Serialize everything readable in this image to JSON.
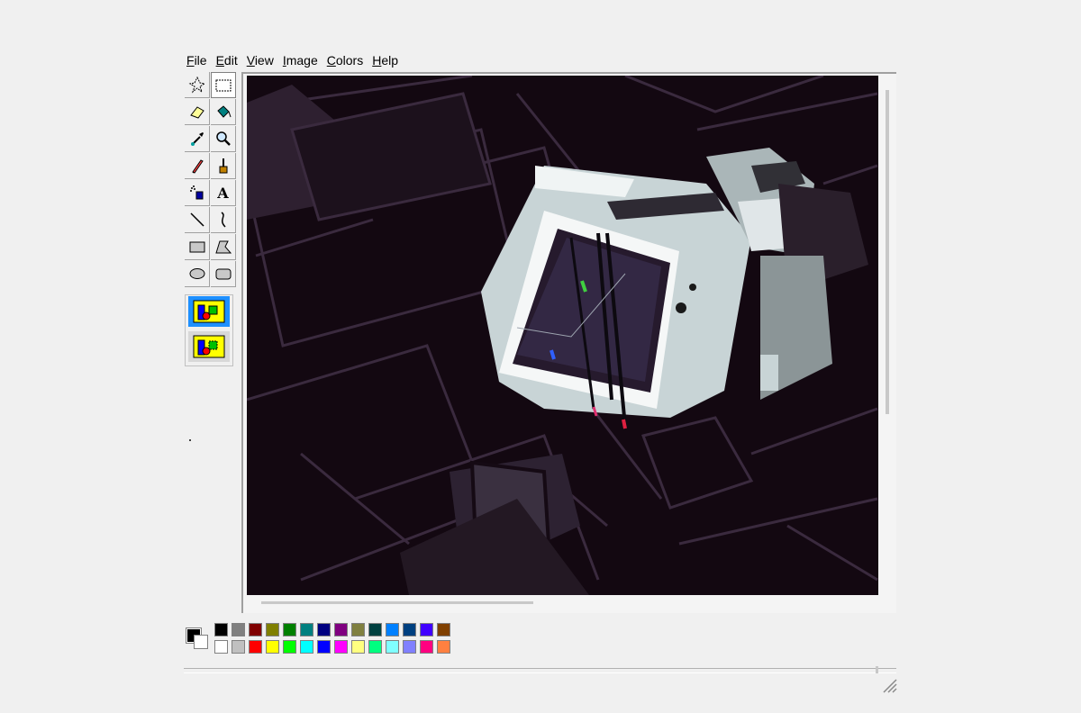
{
  "menu": {
    "items": [
      "File",
      "Edit",
      "View",
      "Image",
      "Colors",
      "Help"
    ]
  },
  "toolbox": {
    "tools": [
      {
        "name": "free-select-icon",
        "active": false
      },
      {
        "name": "rect-select-icon",
        "active": true
      },
      {
        "name": "eraser-icon",
        "active": false
      },
      {
        "name": "fill-bucket-icon",
        "active": false
      },
      {
        "name": "color-picker-icon",
        "active": false
      },
      {
        "name": "magnifier-icon",
        "active": false
      },
      {
        "name": "pencil-icon",
        "active": false
      },
      {
        "name": "brush-icon",
        "active": false
      },
      {
        "name": "airbrush-icon",
        "active": false
      },
      {
        "name": "text-icon",
        "active": false,
        "glyph": "A"
      },
      {
        "name": "line-icon",
        "active": false
      },
      {
        "name": "curve-icon",
        "active": false
      },
      {
        "name": "rectangle-icon",
        "active": false
      },
      {
        "name": "polygon-icon",
        "active": false
      },
      {
        "name": "ellipse-icon",
        "active": false
      },
      {
        "name": "rounded-rectangle-icon",
        "active": false
      }
    ],
    "options": [
      "opaque-selection-icon",
      "transparent-selection-icon"
    ]
  },
  "colors": {
    "foreground": "#000000",
    "background": "#ffffff",
    "palette_top": [
      "#000000",
      "#808080",
      "#800000",
      "#808000",
      "#008000",
      "#008080",
      "#000080",
      "#800080",
      "#808040",
      "#004040",
      "#0080ff",
      "#004080",
      "#4000ff",
      "#804000"
    ],
    "palette_bottom": [
      "#ffffff",
      "#c0c0c0",
      "#ff0000",
      "#ffff00",
      "#00ff00",
      "#00ffff",
      "#0000ff",
      "#ff00ff",
      "#ffff80",
      "#00ff80",
      "#80ffff",
      "#8080ff",
      "#ff0080",
      "#ff8040"
    ]
  },
  "canvas": {
    "background": "#130811",
    "image_description_icon": "camcorder-sketch-image"
  }
}
